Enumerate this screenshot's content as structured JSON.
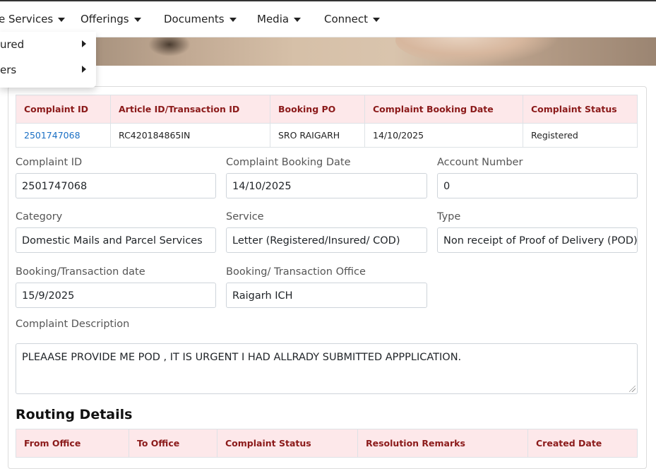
{
  "nav": {
    "items": [
      {
        "label": "e Services"
      },
      {
        "label": "Offerings"
      },
      {
        "label": "Documents"
      },
      {
        "label": "Media"
      },
      {
        "label": "Connect"
      }
    ],
    "dropdown": [
      {
        "label": "ured"
      },
      {
        "label": "ers"
      }
    ]
  },
  "summary_table": {
    "headers": [
      "Complaint ID",
      "Article ID/Transaction ID",
      "Booking PO",
      "Complaint Booking Date",
      "Complaint Status"
    ],
    "row": [
      "2501747068",
      "RC420184865IN",
      "SRO RAIGARH",
      "14/10/2025",
      "Registered"
    ]
  },
  "form": {
    "complaint_id": {
      "label": "Complaint ID",
      "value": "2501747068"
    },
    "booking_date": {
      "label": "Complaint Booking Date",
      "value": "14/10/2025"
    },
    "account_number": {
      "label": "Account Number",
      "value": "0"
    },
    "category": {
      "label": "Category",
      "value": "Domestic Mails and Parcel Services"
    },
    "service": {
      "label": "Service",
      "value": "Letter (Registered/Insured/ COD)"
    },
    "type": {
      "label": "Type",
      "value": "Non receipt of Proof of Delivery (POD)"
    },
    "transaction_date": {
      "label": "Booking/Transaction date",
      "value": "15/9/2025"
    },
    "transaction_office": {
      "label": "Booking/ Transaction Office",
      "value": "Raigarh ICH"
    },
    "description": {
      "label": "Complaint Description",
      "value": "PLEAASE PROVIDE ME POD , IT IS URGENT I HAD ALLRADY SUBMITTED APPPLICATION."
    }
  },
  "routing": {
    "title": "Routing Details",
    "headers": [
      "From Office",
      "To Office",
      "Complaint Status",
      "Resolution Remarks",
      "Created Date"
    ]
  },
  "colors": {
    "header_bg": "#fde8ea",
    "header_text": "#8b1a1a",
    "link": "#1a6fc4"
  }
}
